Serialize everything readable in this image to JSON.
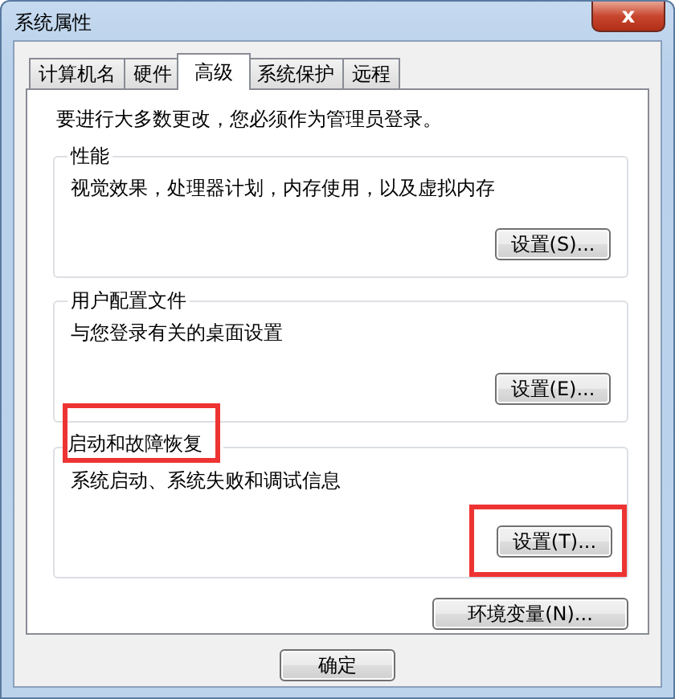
{
  "window": {
    "title": "系统属性",
    "close_glyph": "x"
  },
  "tabs": [
    {
      "label": "计算机名",
      "selected": false
    },
    {
      "label": "硬件",
      "selected": false
    },
    {
      "label": "高级",
      "selected": true
    },
    {
      "label": "系统保护",
      "selected": false
    },
    {
      "label": "远程",
      "selected": false
    }
  ],
  "notice": "要进行大多数更改，您必须作为管理员登录。",
  "groups": [
    {
      "title": "性能",
      "description": "视觉效果，处理器计划，内存使用，以及虚拟内存",
      "button": "设置(S)...",
      "title_highlighted": false,
      "button_highlighted": false
    },
    {
      "title": "用户配置文件",
      "description": "与您登录有关的桌面设置",
      "button": "设置(E)...",
      "title_highlighted": false,
      "button_highlighted": false
    },
    {
      "title": "启动和故障恢复",
      "description": "系统启动、系统失败和调试信息",
      "button": "设置(T)...",
      "title_highlighted": true,
      "button_highlighted": true
    }
  ],
  "env_button": "环境变量(N)...",
  "footer_buttons": [
    "确定"
  ]
}
